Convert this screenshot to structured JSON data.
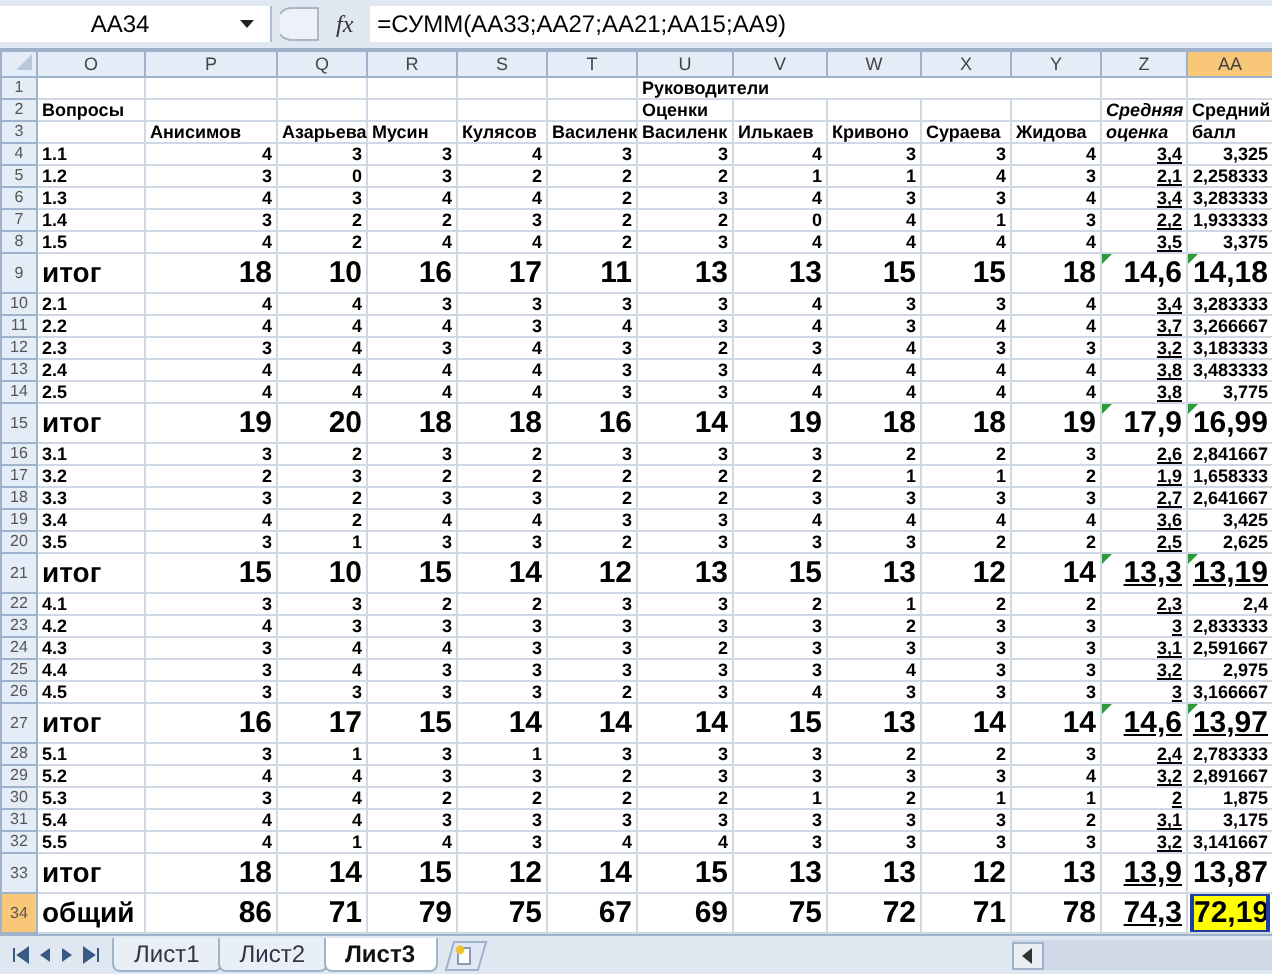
{
  "formula_bar": {
    "name_box": "AA34",
    "fx": "fx",
    "formula": "=СУММ(AA33;AA27;AA21;AA15;AA9)"
  },
  "columns": [
    {
      "label": "O",
      "selected": false
    },
    {
      "label": "P",
      "selected": false
    },
    {
      "label": "Q",
      "selected": false
    },
    {
      "label": "R",
      "selected": false
    },
    {
      "label": "S",
      "selected": false
    },
    {
      "label": "T",
      "selected": false
    },
    {
      "label": "U",
      "selected": false
    },
    {
      "label": "V",
      "selected": false
    },
    {
      "label": "W",
      "selected": false
    },
    {
      "label": "X",
      "selected": false
    },
    {
      "label": "Y",
      "selected": false
    },
    {
      "label": "Z",
      "selected": false
    },
    {
      "label": "AA",
      "selected": true
    }
  ],
  "header": {
    "row_numbers": [
      "1",
      "2",
      "3"
    ],
    "group_title": "Руководители",
    "questions_label": "Вопросы",
    "subtitle": "Оценки",
    "average_label": [
      "Средняя",
      "оценка"
    ],
    "score_label": [
      "Средний",
      "балл"
    ],
    "names": [
      "Анисимов",
      "Азарьева",
      "Мусин",
      "Кулясов",
      "Василенк",
      "Василенк",
      "Илькаев",
      "Кривоно",
      "Сураева",
      "Жидова"
    ]
  },
  "rows": [
    {
      "number": "4",
      "kind": "item",
      "label": "1.1",
      "values": [
        "4",
        "3",
        "3",
        "4",
        "3",
        "3",
        "4",
        "3",
        "3",
        "4"
      ],
      "average": "3,4",
      "score": "3,325",
      "average_underlined": true,
      "score_underlined": false,
      "warning": false,
      "selected": false
    },
    {
      "number": "5",
      "kind": "item",
      "label": "1.2",
      "values": [
        "3",
        "0",
        "3",
        "2",
        "2",
        "2",
        "1",
        "1",
        "4",
        "3"
      ],
      "average": "2,1",
      "score": "2,258333",
      "average_underlined": true,
      "score_underlined": false,
      "warning": false,
      "selected": false
    },
    {
      "number": "6",
      "kind": "item",
      "label": "1.3",
      "values": [
        "4",
        "3",
        "4",
        "4",
        "2",
        "3",
        "4",
        "3",
        "3",
        "4"
      ],
      "average": "3,4",
      "score": "3,283333",
      "average_underlined": true,
      "score_underlined": false,
      "warning": false,
      "selected": false
    },
    {
      "number": "7",
      "kind": "item",
      "label": "1.4",
      "values": [
        "3",
        "2",
        "2",
        "3",
        "2",
        "2",
        "0",
        "4",
        "1",
        "3"
      ],
      "average": "2,2",
      "score": "1,933333",
      "average_underlined": true,
      "score_underlined": false,
      "warning": false,
      "selected": false
    },
    {
      "number": "8",
      "kind": "item",
      "label": "1.5",
      "values": [
        "4",
        "2",
        "4",
        "4",
        "2",
        "3",
        "4",
        "4",
        "4",
        "4"
      ],
      "average": "3,5",
      "score": "3,375",
      "average_underlined": true,
      "score_underlined": false,
      "warning": false,
      "selected": false
    },
    {
      "number": "9",
      "kind": "total",
      "label": "итог",
      "values": [
        "18",
        "10",
        "16",
        "17",
        "11",
        "13",
        "13",
        "15",
        "15",
        "18"
      ],
      "average": "14,6",
      "score": "14,18",
      "average_underlined": false,
      "score_underlined": false,
      "warning": true,
      "selected": false
    },
    {
      "number": "10",
      "kind": "item",
      "label": "2.1",
      "values": [
        "4",
        "4",
        "3",
        "3",
        "3",
        "3",
        "4",
        "3",
        "3",
        "4"
      ],
      "average": "3,4",
      "score": "3,283333",
      "average_underlined": true,
      "score_underlined": false,
      "warning": false,
      "selected": false
    },
    {
      "number": "11",
      "kind": "item",
      "label": "2.2",
      "values": [
        "4",
        "4",
        "4",
        "3",
        "4",
        "3",
        "4",
        "3",
        "4",
        "4"
      ],
      "average": "3,7",
      "score": "3,266667",
      "average_underlined": true,
      "score_underlined": false,
      "warning": false,
      "selected": false
    },
    {
      "number": "12",
      "kind": "item",
      "label": "2.3",
      "values": [
        "3",
        "4",
        "3",
        "4",
        "3",
        "2",
        "3",
        "4",
        "3",
        "3"
      ],
      "average": "3,2",
      "score": "3,183333",
      "average_underlined": true,
      "score_underlined": false,
      "warning": false,
      "selected": false
    },
    {
      "number": "13",
      "kind": "item",
      "label": "2.4",
      "values": [
        "4",
        "4",
        "4",
        "4",
        "3",
        "3",
        "4",
        "4",
        "4",
        "4"
      ],
      "average": "3,8",
      "score": "3,483333",
      "average_underlined": true,
      "score_underlined": false,
      "warning": false,
      "selected": false
    },
    {
      "number": "14",
      "kind": "item",
      "label": "2.5",
      "values": [
        "4",
        "4",
        "4",
        "4",
        "3",
        "3",
        "4",
        "4",
        "4",
        "4"
      ],
      "average": "3,8",
      "score": "3,775",
      "average_underlined": true,
      "score_underlined": false,
      "warning": false,
      "selected": false
    },
    {
      "number": "15",
      "kind": "total",
      "label": "итог",
      "values": [
        "19",
        "20",
        "18",
        "18",
        "16",
        "14",
        "19",
        "18",
        "18",
        "19"
      ],
      "average": "17,9",
      "score": "16,99",
      "average_underlined": false,
      "score_underlined": false,
      "warning": true,
      "selected": false
    },
    {
      "number": "16",
      "kind": "item",
      "label": "3.1",
      "values": [
        "3",
        "2",
        "3",
        "2",
        "3",
        "3",
        "3",
        "2",
        "2",
        "3"
      ],
      "average": "2,6",
      "score": "2,841667",
      "average_underlined": true,
      "score_underlined": false,
      "warning": false,
      "selected": false
    },
    {
      "number": "17",
      "kind": "item",
      "label": "3.2",
      "values": [
        "2",
        "3",
        "2",
        "2",
        "2",
        "2",
        "2",
        "1",
        "1",
        "2"
      ],
      "average": "1,9",
      "score": "1,658333",
      "average_underlined": true,
      "score_underlined": false,
      "warning": false,
      "selected": false
    },
    {
      "number": "18",
      "kind": "item",
      "label": "3.3",
      "values": [
        "3",
        "2",
        "3",
        "3",
        "2",
        "2",
        "3",
        "3",
        "3",
        "3"
      ],
      "average": "2,7",
      "score": "2,641667",
      "average_underlined": true,
      "score_underlined": false,
      "warning": false,
      "selected": false
    },
    {
      "number": "19",
      "kind": "item",
      "label": "3.4",
      "values": [
        "4",
        "2",
        "4",
        "4",
        "3",
        "3",
        "4",
        "4",
        "4",
        "4"
      ],
      "average": "3,6",
      "score": "3,425",
      "average_underlined": true,
      "score_underlined": false,
      "warning": false,
      "selected": false
    },
    {
      "number": "20",
      "kind": "item",
      "label": "3.5",
      "values": [
        "3",
        "1",
        "3",
        "3",
        "2",
        "3",
        "3",
        "3",
        "2",
        "2"
      ],
      "average": "2,5",
      "score": "2,625",
      "average_underlined": true,
      "score_underlined": false,
      "warning": false,
      "selected": false
    },
    {
      "number": "21",
      "kind": "total",
      "label": "итог",
      "values": [
        "15",
        "10",
        "15",
        "14",
        "12",
        "13",
        "15",
        "13",
        "12",
        "14"
      ],
      "average": "13,3",
      "score": "13,19",
      "average_underlined": true,
      "score_underlined": true,
      "warning": true,
      "selected": false
    },
    {
      "number": "22",
      "kind": "item",
      "label": "4.1",
      "values": [
        "3",
        "3",
        "2",
        "2",
        "3",
        "3",
        "2",
        "1",
        "2",
        "2"
      ],
      "average": "2,3",
      "score": "2,4",
      "average_underlined": true,
      "score_underlined": false,
      "warning": false,
      "selected": false
    },
    {
      "number": "23",
      "kind": "item",
      "label": "4.2",
      "values": [
        "4",
        "3",
        "3",
        "3",
        "3",
        "3",
        "3",
        "2",
        "3",
        "3"
      ],
      "average": "3",
      "score": "2,833333",
      "average_underlined": true,
      "score_underlined": false,
      "warning": false,
      "selected": false
    },
    {
      "number": "24",
      "kind": "item",
      "label": "4.3",
      "values": [
        "3",
        "4",
        "4",
        "3",
        "3",
        "2",
        "3",
        "3",
        "3",
        "3"
      ],
      "average": "3,1",
      "score": "2,591667",
      "average_underlined": true,
      "score_underlined": false,
      "warning": false,
      "selected": false
    },
    {
      "number": "25",
      "kind": "item",
      "label": "4.4",
      "values": [
        "3",
        "4",
        "3",
        "3",
        "3",
        "3",
        "3",
        "4",
        "3",
        "3"
      ],
      "average": "3,2",
      "score": "2,975",
      "average_underlined": true,
      "score_underlined": false,
      "warning": false,
      "selected": false
    },
    {
      "number": "26",
      "kind": "item",
      "label": "4.5",
      "values": [
        "3",
        "3",
        "3",
        "3",
        "2",
        "3",
        "4",
        "3",
        "3",
        "3"
      ],
      "average": "3",
      "score": "3,166667",
      "average_underlined": true,
      "score_underlined": false,
      "warning": false,
      "selected": false
    },
    {
      "number": "27",
      "kind": "total",
      "label": "итог",
      "values": [
        "16",
        "17",
        "15",
        "14",
        "14",
        "14",
        "15",
        "13",
        "14",
        "14"
      ],
      "average": "14,6",
      "score": "13,97",
      "average_underlined": true,
      "score_underlined": true,
      "warning": true,
      "selected": false
    },
    {
      "number": "28",
      "kind": "item",
      "label": "5.1",
      "values": [
        "3",
        "1",
        "3",
        "1",
        "3",
        "3",
        "3",
        "2",
        "2",
        "3"
      ],
      "average": "2,4",
      "score": "2,783333",
      "average_underlined": true,
      "score_underlined": false,
      "warning": false,
      "selected": false
    },
    {
      "number": "29",
      "kind": "item",
      "label": "5.2",
      "values": [
        "4",
        "4",
        "3",
        "3",
        "2",
        "3",
        "3",
        "3",
        "3",
        "4"
      ],
      "average": "3,2",
      "score": "2,891667",
      "average_underlined": true,
      "score_underlined": false,
      "warning": false,
      "selected": false
    },
    {
      "number": "30",
      "kind": "item",
      "label": "5.3",
      "values": [
        "3",
        "4",
        "2",
        "2",
        "2",
        "2",
        "1",
        "2",
        "1",
        "1"
      ],
      "average": "2",
      "score": "1,875",
      "average_underlined": true,
      "score_underlined": false,
      "warning": false,
      "selected": false
    },
    {
      "number": "31",
      "kind": "item",
      "label": "5.4",
      "values": [
        "4",
        "4",
        "3",
        "3",
        "3",
        "3",
        "3",
        "3",
        "3",
        "2"
      ],
      "average": "3,1",
      "score": "3,175",
      "average_underlined": true,
      "score_underlined": false,
      "warning": false,
      "selected": false
    },
    {
      "number": "32",
      "kind": "item",
      "label": "5.5",
      "values": [
        "4",
        "1",
        "4",
        "3",
        "4",
        "4",
        "3",
        "3",
        "3",
        "3"
      ],
      "average": "3,2",
      "score": "3,141667",
      "average_underlined": true,
      "score_underlined": false,
      "warning": false,
      "selected": false
    },
    {
      "number": "33",
      "kind": "total",
      "label": "итог",
      "values": [
        "18",
        "14",
        "15",
        "12",
        "14",
        "15",
        "13",
        "13",
        "12",
        "13"
      ],
      "average": "13,9",
      "score": "13,87",
      "average_underlined": true,
      "score_underlined": false,
      "warning": false,
      "selected": false
    },
    {
      "number": "34",
      "kind": "total",
      "label": "общий",
      "values": [
        "86",
        "71",
        "79",
        "75",
        "67",
        "69",
        "75",
        "72",
        "71",
        "78"
      ],
      "average": "74,3",
      "score": "72,19",
      "average_underlined": true,
      "score_underlined": false,
      "warning": false,
      "selected": true
    }
  ],
  "sheet_tabs": [
    {
      "label": "Лист1",
      "selected": false
    },
    {
      "label": "Лист2",
      "selected": false
    },
    {
      "label": "Лист3",
      "selected": true
    }
  ]
}
